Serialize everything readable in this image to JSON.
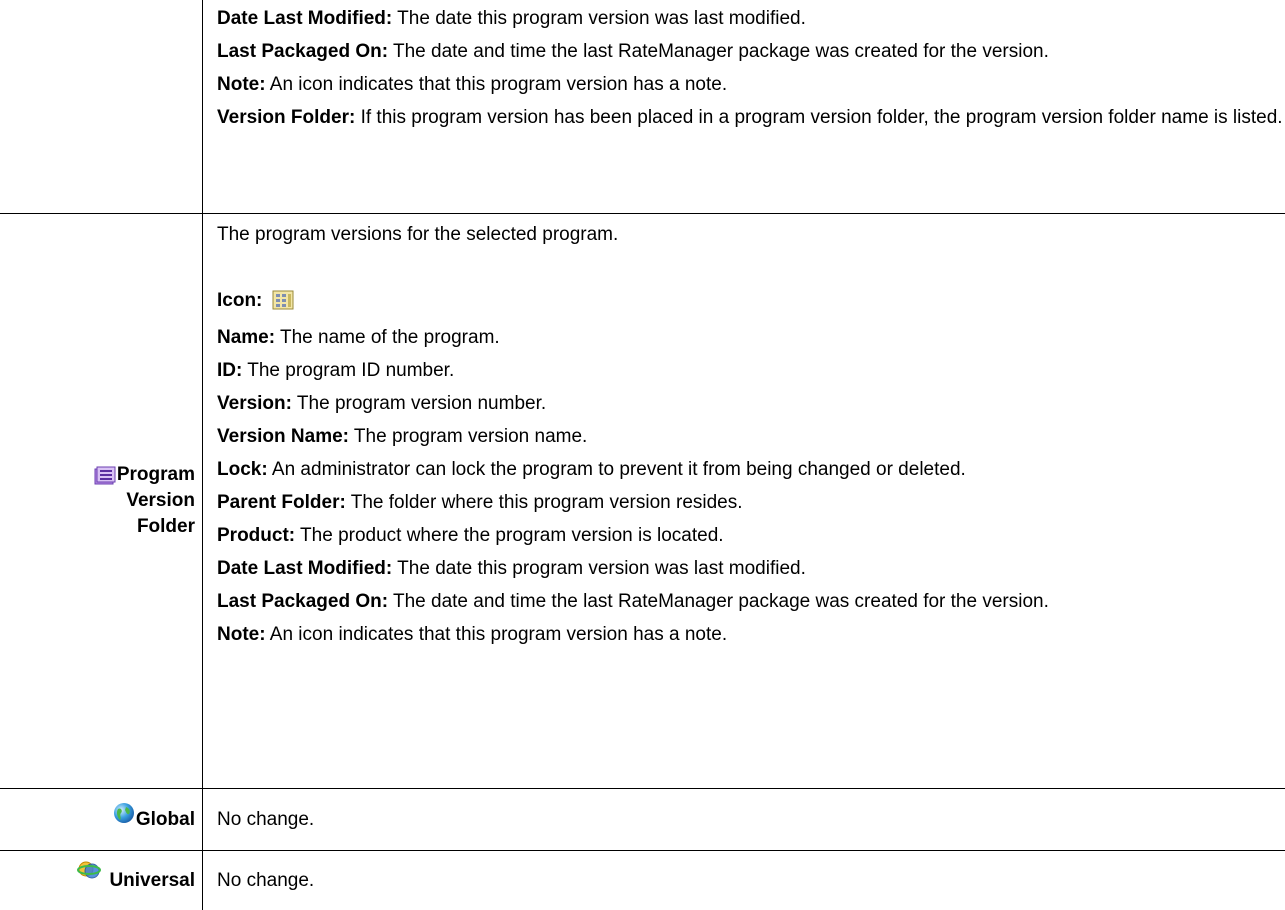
{
  "top_row": {
    "entries": [
      {
        "term": "Date Last Modified:",
        "desc": " The date this program version was last modified."
      },
      {
        "term": "Last Packaged On:",
        "desc": " The date and time the last RateManager package was created for the version."
      },
      {
        "term": "Note:",
        "desc": " An icon indicates that this program version has a note."
      },
      {
        "term": "Version Folder:",
        "desc": " If this program version has been placed in a program version folder, the program version folder name is listed."
      }
    ]
  },
  "folder_row": {
    "label_line1": "Program",
    "label_line2": "Version",
    "label_line3": "Folder",
    "icon": "program-version-folder-icon",
    "intro": "The program versions for the selected program.",
    "icon_term": "Icon:",
    "icon_term_icon": "program-version-icon",
    "entries": [
      {
        "term": "Name:",
        "desc": " The name of the program."
      },
      {
        "term": "ID:",
        "desc": " The program ID number."
      },
      {
        "term": "Version:",
        "desc": " The program version number."
      },
      {
        "term": "Version Name:",
        "desc": " The program version name."
      },
      {
        "term": "Lock:",
        "desc": " An administrator can lock the program to prevent it from being changed or deleted."
      },
      {
        "term": "Parent Folder:",
        "desc": " The folder where this program version resides."
      },
      {
        "term": "Product:",
        "desc": " The product where the program version is located."
      },
      {
        "term": "Date Last Modified:",
        "desc": " The date this program version was last modified."
      },
      {
        "term": "Last Packaged On:",
        "desc": " The date and time the last RateManager package was created for the version."
      },
      {
        "term": "Note:",
        "desc": " An icon indicates that this program version has a note."
      }
    ]
  },
  "global_row": {
    "label": "Global",
    "icon": "globe-icon",
    "desc": "No change."
  },
  "universal_row": {
    "label": "Universal",
    "icon": "universal-orb-icon",
    "desc": "No change."
  }
}
